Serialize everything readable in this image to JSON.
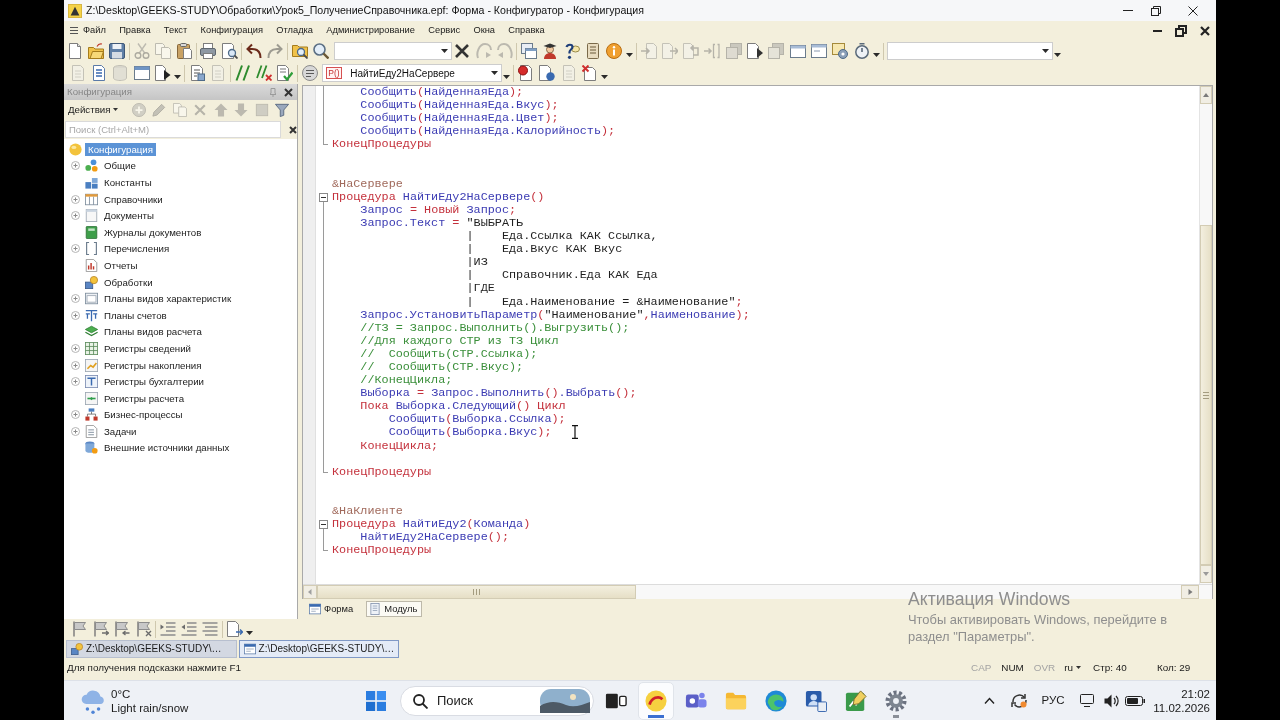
{
  "window": {
    "title": "Z:\\Desktop\\GEEKS-STUDY\\Обработки\\Урок5_ПолучениеСправочника.epf: Форма - Конфигуратор - Конфигурация"
  },
  "menu": [
    "Файл",
    "Правка",
    "Текст",
    "Конфигурация",
    "Отладка",
    "Администрирование",
    "Сервис",
    "Окна",
    "Справка"
  ],
  "toolbar_1": [
    {
      "kind": "button",
      "disabled": false
    },
    {
      "kind": "button",
      "disabled": false
    },
    {
      "kind": "button",
      "disabled": false
    },
    {
      "kind": "separator"
    },
    {
      "kind": "button",
      "disabled": true
    },
    {
      "kind": "button",
      "disabled": true
    },
    {
      "kind": "button",
      "disabled": false
    },
    {
      "kind": "separator"
    },
    {
      "kind": "button",
      "disabled": false
    },
    {
      "kind": "button",
      "disabled": false
    },
    {
      "kind": "separator"
    },
    {
      "kind": "button",
      "disabled": false
    },
    {
      "kind": "button",
      "disabled": true
    },
    {
      "kind": "separator"
    },
    {
      "kind": "button",
      "disabled": false
    },
    {
      "kind": "button",
      "disabled": false
    },
    {
      "kind": "combo"
    },
    {
      "kind": "button",
      "disabled": false
    },
    {
      "kind": "button",
      "disabled": true
    },
    {
      "kind": "button",
      "disabled": true
    },
    {
      "kind": "separator"
    },
    {
      "kind": "button",
      "disabled": false
    },
    {
      "kind": "button",
      "disabled": false
    },
    {
      "kind": "button",
      "disabled": false
    },
    {
      "kind": "button",
      "disabled": false
    },
    {
      "kind": "button",
      "disabled": false
    },
    {
      "kind": "dropdown"
    },
    {
      "kind": "separator"
    },
    {
      "kind": "button",
      "disabled": true
    },
    {
      "kind": "button",
      "disabled": true
    },
    {
      "kind": "button",
      "disabled": true
    },
    {
      "kind": "button",
      "disabled": true
    },
    {
      "kind": "button",
      "disabled": true
    },
    {
      "kind": "button",
      "disabled": false
    },
    {
      "kind": "button",
      "disabled": true
    },
    {
      "kind": "button",
      "disabled": false
    },
    {
      "kind": "button",
      "disabled": false
    },
    {
      "kind": "button",
      "disabled": false
    },
    {
      "kind": "button",
      "disabled": false
    },
    {
      "kind": "dropdown"
    },
    {
      "kind": "separator"
    },
    {
      "kind": "combo"
    },
    {
      "kind": "dropdown"
    }
  ],
  "toolbar_2": [
    {
      "kind": "button",
      "disabled": true
    },
    {
      "kind": "button",
      "disabled": false
    },
    {
      "kind": "button",
      "disabled": true
    },
    {
      "kind": "button",
      "disabled": false
    },
    {
      "kind": "button",
      "disabled": false
    },
    {
      "kind": "dropdown"
    },
    {
      "kind": "separator"
    },
    {
      "kind": "button",
      "disabled": false
    },
    {
      "kind": "button",
      "disabled": true
    },
    {
      "kind": "separator"
    },
    {
      "kind": "button",
      "disabled": false
    },
    {
      "kind": "button",
      "disabled": false
    },
    {
      "kind": "button",
      "disabled": false
    },
    {
      "kind": "separator"
    },
    {
      "kind": "button",
      "disabled": false
    },
    {
      "kind": "combo",
      "badge": "P()",
      "value": "НайтиЕду2НаСервере"
    },
    {
      "kind": "dropdown"
    },
    {
      "kind": "separator"
    },
    {
      "kind": "button",
      "disabled": false
    },
    {
      "kind": "button",
      "disabled": false
    },
    {
      "kind": "button",
      "disabled": true
    },
    {
      "kind": "button",
      "disabled": false
    },
    {
      "kind": "dropdown"
    }
  ],
  "sidebar": {
    "title": "Конфигурация",
    "actions": {
      "label": "Действия",
      "buttons": [
        {
          "disabled": true
        },
        {
          "disabled": true
        },
        {
          "disabled": true
        },
        {
          "disabled": true
        },
        {
          "disabled": true
        },
        {
          "disabled": true
        },
        {
          "disabled": true
        },
        {
          "disabled": false
        }
      ]
    },
    "search": {
      "placeholder": "Поиск (Ctrl+Alt+M)"
    },
    "tree": [
      {
        "label": "Конфигурация",
        "kind": "root",
        "selected": true,
        "children": [
          {
            "label": "Общие",
            "kind": "group",
            "expanded": false,
            "selected": false
          },
          {
            "label": "Константы",
            "kind": "leaf",
            "selected": false
          },
          {
            "label": "Справочники",
            "kind": "group",
            "expanded": false,
            "selected": false
          },
          {
            "label": "Документы",
            "kind": "group",
            "expanded": false,
            "selected": false
          },
          {
            "label": "Журналы документов",
            "kind": "leaf",
            "selected": false
          },
          {
            "label": "Перечисления",
            "kind": "group",
            "expanded": false,
            "selected": false
          },
          {
            "label": "Отчеты",
            "kind": "leaf",
            "selected": false
          },
          {
            "label": "Обработки",
            "kind": "leaf",
            "selected": false
          },
          {
            "label": "Планы видов характеристик",
            "kind": "group",
            "expanded": false,
            "selected": false
          },
          {
            "label": "Планы счетов",
            "kind": "group",
            "expanded": false,
            "selected": false
          },
          {
            "label": "Планы видов расчета",
            "kind": "leaf",
            "selected": false
          },
          {
            "label": "Регистры сведений",
            "kind": "group",
            "expanded": false,
            "selected": false
          },
          {
            "label": "Регистры накопления",
            "kind": "group",
            "expanded": false,
            "selected": false
          },
          {
            "label": "Регистры бухгалтерии",
            "kind": "group",
            "expanded": false,
            "selected": false
          },
          {
            "label": "Регистры расчета",
            "kind": "leaf",
            "selected": false
          },
          {
            "label": "Бизнес-процессы",
            "kind": "group",
            "expanded": false,
            "selected": false
          },
          {
            "label": "Задачи",
            "kind": "group",
            "expanded": false,
            "selected": false
          },
          {
            "label": "Внешние источники данных",
            "kind": "leaf",
            "selected": false
          }
        ]
      }
    ]
  },
  "editor": {
    "lines": [
      {
        "kind": "code",
        "tokens": [
          {
            "kind": "name",
            "text": "    Сообщить"
          },
          {
            "kind": "op",
            "text": "("
          },
          {
            "kind": "name",
            "text": "НайденнаяЕда"
          },
          {
            "kind": "op",
            "text": ");"
          }
        ]
      },
      {
        "kind": "code",
        "tokens": [
          {
            "kind": "name",
            "text": "    Сообщить"
          },
          {
            "kind": "op",
            "text": "("
          },
          {
            "kind": "name",
            "text": "НайденнаяЕда.Вкус"
          },
          {
            "kind": "op",
            "text": ");"
          }
        ]
      },
      {
        "kind": "code",
        "tokens": [
          {
            "kind": "name",
            "text": "    Сообщить"
          },
          {
            "kind": "op",
            "text": "("
          },
          {
            "kind": "name",
            "text": "НайденнаяЕда.Цвет"
          },
          {
            "kind": "op",
            "text": ");"
          }
        ]
      },
      {
        "kind": "code",
        "tokens": [
          {
            "kind": "name",
            "text": "    Сообщить"
          },
          {
            "kind": "op",
            "text": "("
          },
          {
            "kind": "name",
            "text": "НайденнаяЕда.Калорийность"
          },
          {
            "kind": "op",
            "text": ");"
          }
        ]
      },
      {
        "kind": "block-end",
        "tokens": [
          {
            "kind": "kw",
            "text": "КонецПроцедуры"
          }
        ]
      },
      {
        "kind": "blank"
      },
      {
        "kind": "blank"
      },
      {
        "kind": "code",
        "tokens": [
          {
            "kind": "directive",
            "text": "&НаСервере"
          }
        ]
      },
      {
        "kind": "block-start",
        "expanded": true,
        "tokens": [
          {
            "kind": "kw",
            "text": "Процедура "
          },
          {
            "kind": "name",
            "text": "НайтиЕду2НаСервере"
          },
          {
            "kind": "op",
            "text": "()"
          }
        ]
      },
      {
        "kind": "code",
        "tokens": [
          {
            "kind": "name",
            "text": "    Запрос"
          },
          {
            "kind": "op",
            "text": " = "
          },
          {
            "kind": "kw",
            "text": "Новый"
          },
          {
            "kind": "name",
            "text": " Запрос"
          },
          {
            "kind": "op",
            "text": ";"
          }
        ]
      },
      {
        "kind": "code",
        "tokens": [
          {
            "kind": "name",
            "text": "    Запрос.Текст"
          },
          {
            "kind": "op",
            "text": " = "
          },
          {
            "kind": "str",
            "text": "\"ВЫБРАТЬ"
          }
        ]
      },
      {
        "kind": "code",
        "tokens": [
          {
            "kind": "str",
            "text": "                   |    Еда.Ссылка КАК Ссылка,"
          }
        ]
      },
      {
        "kind": "code",
        "tokens": [
          {
            "kind": "str",
            "text": "                   |    Еда.Вкус КАК Вкус"
          }
        ]
      },
      {
        "kind": "code",
        "tokens": [
          {
            "kind": "str",
            "text": "                   |ИЗ"
          }
        ]
      },
      {
        "kind": "code",
        "tokens": [
          {
            "kind": "str",
            "text": "                   |    Справочник.Еда КАК Еда"
          }
        ]
      },
      {
        "kind": "code",
        "tokens": [
          {
            "kind": "str",
            "text": "                   |ГДЕ"
          }
        ]
      },
      {
        "kind": "code",
        "tokens": [
          {
            "kind": "str",
            "text": "                   |    Еда.Наименование = &Наименование\""
          },
          {
            "kind": "op",
            "text": ";"
          }
        ]
      },
      {
        "kind": "code",
        "tokens": [
          {
            "kind": "name",
            "text": "    Запрос.УстановитьПараметр"
          },
          {
            "kind": "op",
            "text": "("
          },
          {
            "kind": "str",
            "text": "\"Наименование\""
          },
          {
            "kind": "op",
            "text": ","
          },
          {
            "kind": "name",
            "text": "Наименование"
          },
          {
            "kind": "op",
            "text": ");"
          }
        ]
      },
      {
        "kind": "code",
        "tokens": [
          {
            "kind": "comment",
            "text": "    //ТЗ = Запрос.Выполнить().Выгрузить();"
          }
        ]
      },
      {
        "kind": "code",
        "tokens": [
          {
            "kind": "comment",
            "text": "    //Для каждого СТР из ТЗ Цикл"
          }
        ]
      },
      {
        "kind": "code",
        "tokens": [
          {
            "kind": "comment",
            "text": "    //  Сообщить(СТР.Ссылка);"
          }
        ]
      },
      {
        "kind": "code",
        "tokens": [
          {
            "kind": "comment",
            "text": "    //  Сообщить(СТР.Вкус);"
          }
        ]
      },
      {
        "kind": "code",
        "tokens": [
          {
            "kind": "comment",
            "text": "    //КонецЦикла;"
          }
        ]
      },
      {
        "kind": "code",
        "tokens": [
          {
            "kind": "name",
            "text": "    Выборка"
          },
          {
            "kind": "op",
            "text": " = "
          },
          {
            "kind": "name",
            "text": "Запрос.Выполнить"
          },
          {
            "kind": "op",
            "text": "()"
          },
          {
            "kind": "name",
            "text": ".Выбрать"
          },
          {
            "kind": "op",
            "text": "();"
          }
        ]
      },
      {
        "kind": "code",
        "tokens": [
          {
            "kind": "kw",
            "text": "    Пока"
          },
          {
            "kind": "name",
            "text": " Выборка.Следующий"
          },
          {
            "kind": "op",
            "text": "()"
          },
          {
            "kind": "kw",
            "text": " Цикл"
          }
        ]
      },
      {
        "kind": "code",
        "tokens": [
          {
            "kind": "name",
            "text": "        Сообщить"
          },
          {
            "kind": "op",
            "text": "("
          },
          {
            "kind": "name",
            "text": "Выборка.Ссылка"
          },
          {
            "kind": "op",
            "text": ");"
          }
        ]
      },
      {
        "kind": "code",
        "tokens": [
          {
            "kind": "name",
            "text": "        Сообщить"
          },
          {
            "kind": "op",
            "text": "("
          },
          {
            "kind": "name",
            "text": "Выборка.Вкус"
          },
          {
            "kind": "op",
            "text": ");"
          }
        ]
      },
      {
        "kind": "code",
        "tokens": [
          {
            "kind": "kw",
            "text": "    КонецЦикла"
          },
          {
            "kind": "op",
            "text": ";"
          }
        ]
      },
      {
        "kind": "blank"
      },
      {
        "kind": "block-end",
        "tokens": [
          {
            "kind": "kw",
            "text": "КонецПроцедуры"
          }
        ]
      },
      {
        "kind": "blank"
      },
      {
        "kind": "blank"
      },
      {
        "kind": "code",
        "tokens": [
          {
            "kind": "directive",
            "text": "&НаКлиенте"
          }
        ]
      },
      {
        "kind": "block-start",
        "expanded": true,
        "tokens": [
          {
            "kind": "kw",
            "text": "Процедура "
          },
          {
            "kind": "name",
            "text": "НайтиЕду2"
          },
          {
            "kind": "op",
            "text": "("
          },
          {
            "kind": "name",
            "text": "Команда"
          },
          {
            "kind": "op",
            "text": ")"
          }
        ]
      },
      {
        "kind": "code",
        "tokens": [
          {
            "kind": "name",
            "text": "    НайтиЕду2НаСервере"
          },
          {
            "kind": "op",
            "text": "();"
          }
        ]
      },
      {
        "kind": "block-end",
        "tokens": [
          {
            "kind": "kw",
            "text": "КонецПроцедуры"
          }
        ]
      }
    ],
    "tabs": [
      {
        "label": "Форма",
        "selected": false
      },
      {
        "label": "Модуль",
        "selected": true
      }
    ]
  },
  "bottom_toolbar": [
    {
      "kind": "button",
      "disabled": false
    },
    {
      "kind": "button",
      "disabled": false
    },
    {
      "kind": "button",
      "disabled": false
    },
    {
      "kind": "button",
      "disabled": false
    },
    {
      "kind": "separator"
    },
    {
      "kind": "button",
      "disabled": false
    },
    {
      "kind": "button",
      "disabled": false
    },
    {
      "kind": "button",
      "disabled": false
    },
    {
      "kind": "separator"
    },
    {
      "kind": "button",
      "disabled": false
    },
    {
      "kind": "dropdown"
    }
  ],
  "window_tabs": [
    {
      "label": "Z:\\Desktop\\GEEKS-STUDY\\…",
      "selected": false
    },
    {
      "label": "Z:\\Desktop\\GEEKS-STUDY\\…",
      "selected": true
    }
  ],
  "status_bar": {
    "hint": "Для получения подсказки нажмите F1",
    "indicators": [
      {
        "label": "CAP",
        "on": false
      },
      {
        "label": "NUM",
        "on": true
      },
      {
        "label": "OVR",
        "on": false
      }
    ],
    "language": "ru",
    "line": "Стр: 40",
    "column": "Кол: 29"
  },
  "activation_notice": {
    "title": "Активация Windows",
    "lines": [
      "Чтобы активировать Windows, перейдите в",
      "раздел \"Параметры\"."
    ]
  },
  "taskbar": {
    "weather": {
      "temperature": "0°C",
      "condition": "Light rain/snow"
    },
    "search": {
      "placeholder": "Поиск"
    },
    "apps": [
      {
        "selected": false,
        "running": false
      },
      {
        "selected": true,
        "running": true
      },
      {
        "selected": false,
        "running": false
      },
      {
        "selected": false,
        "running": false
      },
      {
        "selected": false,
        "running": false
      },
      {
        "selected": false,
        "running": false
      },
      {
        "selected": false,
        "running": false
      },
      {
        "selected": false,
        "running": true
      }
    ],
    "language": "РУС",
    "time": "21:02",
    "date": "11.02.2026"
  }
}
